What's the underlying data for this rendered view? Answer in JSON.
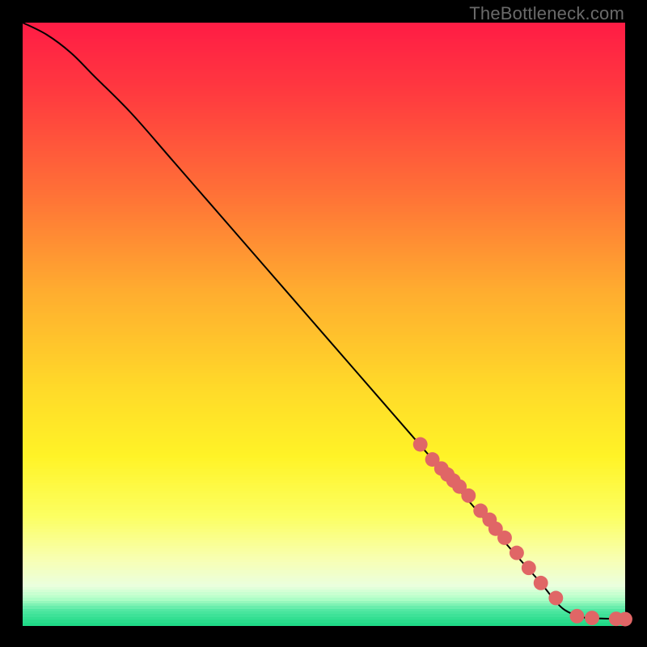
{
  "watermark": "TheBottleneck.com",
  "colors": {
    "marker": "#E06666",
    "line": "#000000",
    "frame": "#000000"
  },
  "chart_data": {
    "type": "line",
    "title": "",
    "xlabel": "",
    "ylabel": "",
    "xlim": [
      0,
      100
    ],
    "ylim": [
      0,
      100
    ],
    "gradient": [
      {
        "pos": 0.0,
        "color": "#FF1C45"
      },
      {
        "pos": 0.12,
        "color": "#FF3B3F"
      },
      {
        "pos": 0.28,
        "color": "#FF7037"
      },
      {
        "pos": 0.45,
        "color": "#FFAE2F"
      },
      {
        "pos": 0.6,
        "color": "#FFD829"
      },
      {
        "pos": 0.72,
        "color": "#FFF327"
      },
      {
        "pos": 0.82,
        "color": "#FCFF62"
      },
      {
        "pos": 0.89,
        "color": "#F8FFB2"
      },
      {
        "pos": 0.935,
        "color": "#EAFFDE"
      },
      {
        "pos": 0.955,
        "color": "#B6FFC9"
      },
      {
        "pos": 0.975,
        "color": "#52E8A3"
      },
      {
        "pos": 1.0,
        "color": "#1BD784"
      }
    ],
    "series": [
      {
        "name": "bottleneck-curve",
        "x": [
          0,
          4,
          8,
          12,
          18,
          25,
          35,
          45,
          55,
          65,
          75,
          82,
          86,
          88,
          90,
          93,
          96,
          100
        ],
        "y": [
          100,
          98,
          95,
          91,
          85,
          77,
          65.5,
          54,
          42.5,
          31,
          19.5,
          11.5,
          7,
          4.5,
          2.5,
          1.3,
          1.1,
          1.0
        ]
      }
    ],
    "markers": {
      "name": "data-points",
      "x": [
        66,
        68,
        69.5,
        70.5,
        71.5,
        72.5,
        74,
        76,
        77.5,
        78.5,
        80,
        82,
        84,
        86,
        88.5,
        92,
        94.5,
        98.5,
        100
      ],
      "y": [
        30,
        27.5,
        26,
        25,
        24,
        23,
        21.5,
        19,
        17.5,
        16,
        14.5,
        12,
        9.5,
        7,
        4.5,
        1.5,
        1.2,
        1.05,
        1.0
      ]
    }
  }
}
